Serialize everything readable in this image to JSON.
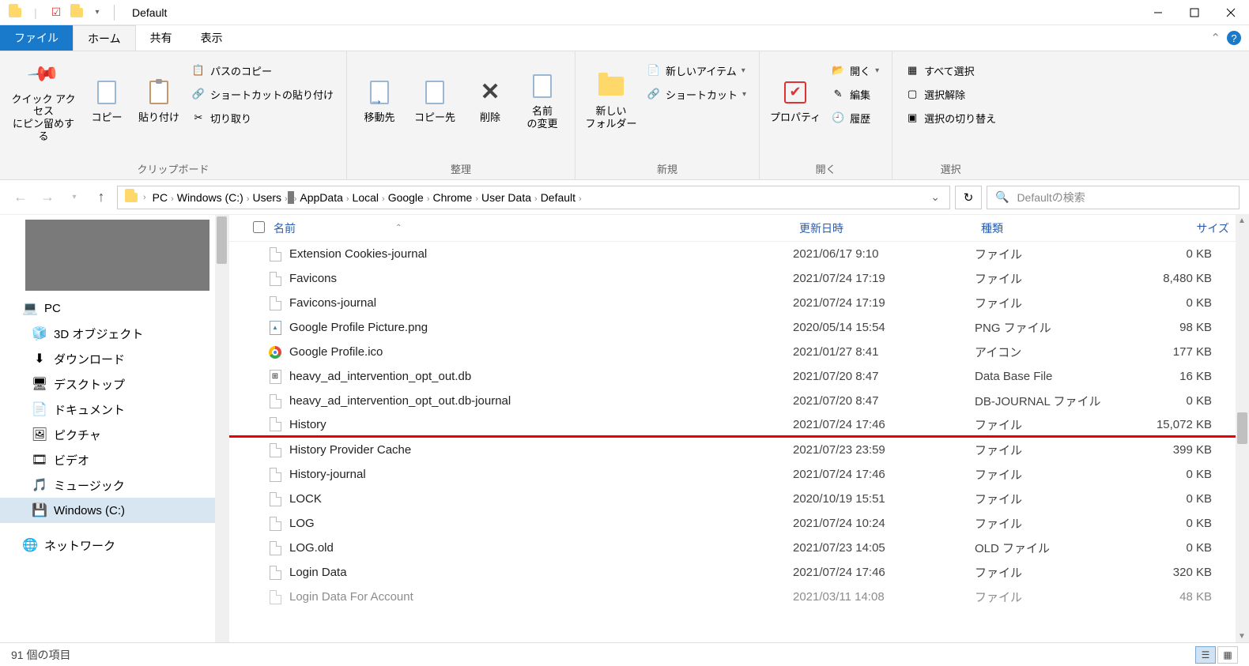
{
  "window": {
    "title": "Default"
  },
  "ribbon": {
    "tabs": {
      "file": "ファイル",
      "home": "ホーム",
      "share": "共有",
      "view": "表示"
    },
    "clipboard": {
      "pin_quick": "クイック アクセス\nにピン留めする",
      "copy": "コピー",
      "paste": "貼り付け",
      "copy_path": "パスのコピー",
      "paste_shortcut": "ショートカットの貼り付け",
      "cut": "切り取り",
      "group": "クリップボード"
    },
    "organize": {
      "move_to": "移動先",
      "copy_to": "コピー先",
      "delete": "削除",
      "rename": "名前\nの変更",
      "group": "整理"
    },
    "new": {
      "new_folder": "新しい\nフォルダー",
      "new_item": "新しいアイテム",
      "shortcut": "ショートカット",
      "group": "新規"
    },
    "open": {
      "properties": "プロパティ",
      "open": "開く",
      "edit": "編集",
      "history": "履歴",
      "group": "開く"
    },
    "select": {
      "select_all": "すべて選択",
      "deselect": "選択解除",
      "invert": "選択の切り替え",
      "group": "選択"
    }
  },
  "breadcrumbs": [
    "PC",
    "Windows (C:)",
    "Users",
    "",
    "AppData",
    "Local",
    "Google",
    "Chrome",
    "User Data",
    "Default"
  ],
  "search": {
    "placeholder": "Defaultの検索"
  },
  "sidebar": {
    "pc": "PC",
    "items": [
      {
        "icon": "cube",
        "label": "3D オブジェクト"
      },
      {
        "icon": "download",
        "label": "ダウンロード"
      },
      {
        "icon": "desktop",
        "label": "デスクトップ"
      },
      {
        "icon": "document",
        "label": "ドキュメント"
      },
      {
        "icon": "picture",
        "label": "ピクチャ"
      },
      {
        "icon": "video",
        "label": "ビデオ"
      },
      {
        "icon": "music",
        "label": "ミュージック"
      },
      {
        "icon": "drive",
        "label": "Windows (C:)"
      }
    ],
    "network": "ネットワーク"
  },
  "columns": {
    "name": "名前",
    "date": "更新日時",
    "type": "種類",
    "size": "サイズ"
  },
  "files": [
    {
      "icon": "blank",
      "name": "Extension Cookies-journal",
      "date": "2021/06/17 9:10",
      "type": "ファイル",
      "size": "0 KB"
    },
    {
      "icon": "blank",
      "name": "Favicons",
      "date": "2021/07/24 17:19",
      "type": "ファイル",
      "size": "8,480 KB"
    },
    {
      "icon": "blank",
      "name": "Favicons-journal",
      "date": "2021/07/24 17:19",
      "type": "ファイル",
      "size": "0 KB"
    },
    {
      "icon": "png",
      "name": "Google Profile Picture.png",
      "date": "2020/05/14 15:54",
      "type": "PNG ファイル",
      "size": "98 KB"
    },
    {
      "icon": "chrome",
      "name": "Google Profile.ico",
      "date": "2021/01/27 8:41",
      "type": "アイコン",
      "size": "177 KB"
    },
    {
      "icon": "db",
      "name": "heavy_ad_intervention_opt_out.db",
      "date": "2021/07/20 8:47",
      "type": "Data Base File",
      "size": "16 KB"
    },
    {
      "icon": "blank",
      "name": "heavy_ad_intervention_opt_out.db-journal",
      "date": "2021/07/20 8:47",
      "type": "DB-JOURNAL ファイル",
      "size": "0 KB"
    },
    {
      "icon": "blank",
      "name": "History",
      "date": "2021/07/24 17:46",
      "type": "ファイル",
      "size": "15,072 KB",
      "highlight": true
    },
    {
      "icon": "blank",
      "name": "History Provider Cache",
      "date": "2021/07/23 23:59",
      "type": "ファイル",
      "size": "399 KB"
    },
    {
      "icon": "blank",
      "name": "History-journal",
      "date": "2021/07/24 17:46",
      "type": "ファイル",
      "size": "0 KB"
    },
    {
      "icon": "blank",
      "name": "LOCK",
      "date": "2020/10/19 15:51",
      "type": "ファイル",
      "size": "0 KB"
    },
    {
      "icon": "blank",
      "name": "LOG",
      "date": "2021/07/24 10:24",
      "type": "ファイル",
      "size": "0 KB"
    },
    {
      "icon": "blank",
      "name": "LOG.old",
      "date": "2021/07/23 14:05",
      "type": "OLD ファイル",
      "size": "0 KB"
    },
    {
      "icon": "blank",
      "name": "Login Data",
      "date": "2021/07/24 17:46",
      "type": "ファイル",
      "size": "320 KB"
    },
    {
      "icon": "blank",
      "name": "Login Data For Account",
      "date": "2021/03/11 14:08",
      "type": "ファイル",
      "size": "48 KB",
      "cut": true
    }
  ],
  "status": {
    "items": "91 個の項目"
  }
}
